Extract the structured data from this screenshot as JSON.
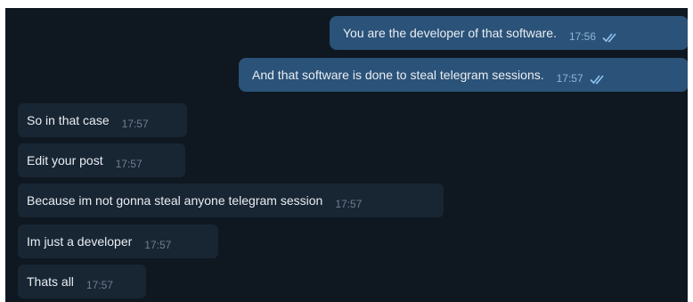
{
  "colors": {
    "chat_background": "#0f1821",
    "outgoing_bubble": "#2b5278",
    "incoming_bubble": "#182533",
    "message_text": "#e9eef3",
    "outgoing_time": "#8fb6d9",
    "incoming_time": "#6d7f8f",
    "read_ticks": "#8fc3f0"
  },
  "messages": [
    {
      "direction": "outgoing",
      "text": "You are the developer of that software.",
      "time": "17:56",
      "status_icon": "double-check-read-icon"
    },
    {
      "direction": "outgoing",
      "text": "And that software is done to steal telegram sessions.",
      "time": "17:57",
      "status_icon": "double-check-read-icon"
    },
    {
      "direction": "incoming",
      "text": "So in that case",
      "time": "17:57"
    },
    {
      "direction": "incoming",
      "text": "Edit your post",
      "time": "17:57"
    },
    {
      "direction": "incoming",
      "text": "Because im not gonna steal anyone telegram session",
      "time": "17:57"
    },
    {
      "direction": "incoming",
      "text": "Im just a developer",
      "time": "17:57"
    },
    {
      "direction": "incoming",
      "text": "Thats all",
      "time": "17:57"
    }
  ]
}
